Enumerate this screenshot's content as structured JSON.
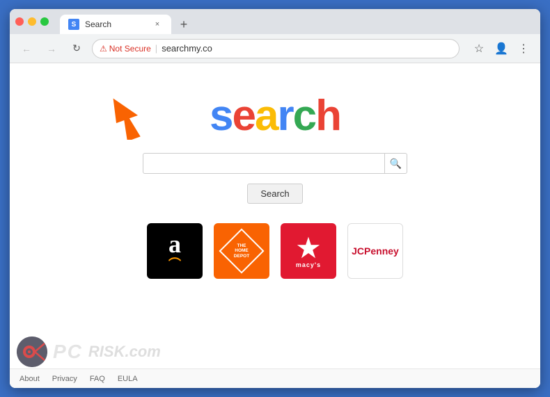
{
  "browser": {
    "tab_title": "Search",
    "tab_close": "×",
    "new_tab": "+",
    "url": "searchmy.co",
    "not_secure_label": "Not Secure",
    "nav": {
      "back": "←",
      "forward": "→",
      "refresh": "↻"
    }
  },
  "page": {
    "logo_letters": [
      {
        "char": "s",
        "class": "s-blue"
      },
      {
        "char": "e",
        "class": "s-red"
      },
      {
        "char": "a",
        "class": "s-yellow"
      },
      {
        "char": "r",
        "class": "s-blue2"
      },
      {
        "char": "c",
        "class": "s-green"
      },
      {
        "char": "h",
        "class": "s-red2"
      }
    ],
    "search_placeholder": "",
    "search_button_label": "Search",
    "quick_links": [
      {
        "name": "Amazon",
        "type": "amazon"
      },
      {
        "name": "The Home Depot",
        "type": "homedepot"
      },
      {
        "name": "Macy's",
        "type": "macys"
      },
      {
        "name": "JCPenney",
        "type": "jcpenney"
      }
    ],
    "footer_links": [
      {
        "label": "About"
      },
      {
        "label": "Privacy"
      },
      {
        "label": "FAQ"
      },
      {
        "label": "EULA"
      }
    ]
  },
  "watermark": {
    "text": "PC",
    "domain": "RISK.com"
  }
}
